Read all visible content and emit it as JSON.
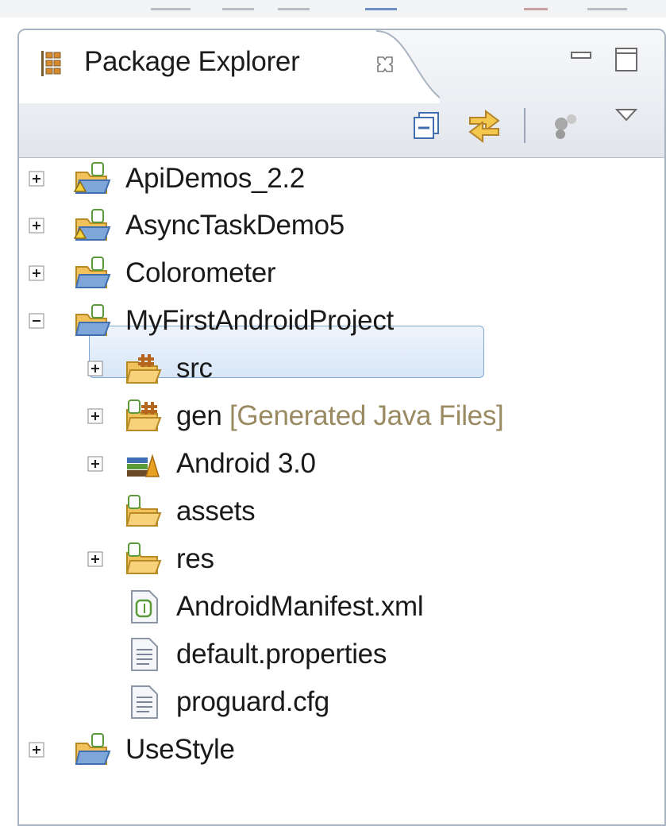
{
  "view": {
    "title": "Package Explorer",
    "close_glyph": "☒"
  },
  "toolbar": {
    "collapse_icon": "collapse-all-icon",
    "link_icon": "link-with-editor-icon",
    "filter_icon": "filter-icon",
    "menu_icon": "view-menu-icon"
  },
  "tree": [
    {
      "label": "ApiDemos_2.2",
      "icon": "project-warning-icon"
    },
    {
      "label": "AsyncTaskDemo5",
      "icon": "project-warning-icon"
    },
    {
      "label": "Colorometer",
      "icon": "project-icon"
    },
    {
      "label": "MyFirstAndroidProject",
      "icon": "project-icon",
      "expanded": true,
      "selected": true
    },
    {
      "label": "src",
      "icon": "source-folder-icon"
    },
    {
      "label": "gen",
      "decoration": "[Generated Java Files]",
      "icon": "gen-folder-icon"
    },
    {
      "label": "Android 3.0",
      "icon": "library-icon"
    },
    {
      "label": "assets",
      "icon": "folder-icon"
    },
    {
      "label": "res",
      "icon": "folder-icon"
    },
    {
      "label": "AndroidManifest.xml",
      "icon": "manifest-file-icon"
    },
    {
      "label": "default.properties",
      "icon": "text-file-icon"
    },
    {
      "label": "proguard.cfg",
      "icon": "text-file-icon"
    },
    {
      "label": "UseStyle",
      "icon": "project-icon"
    }
  ],
  "colors": {
    "selection": "#d8e6f7",
    "selection_border": "#7fa7d6",
    "decoration_text": "#9a8a62",
    "folder": "#f2c25a"
  }
}
